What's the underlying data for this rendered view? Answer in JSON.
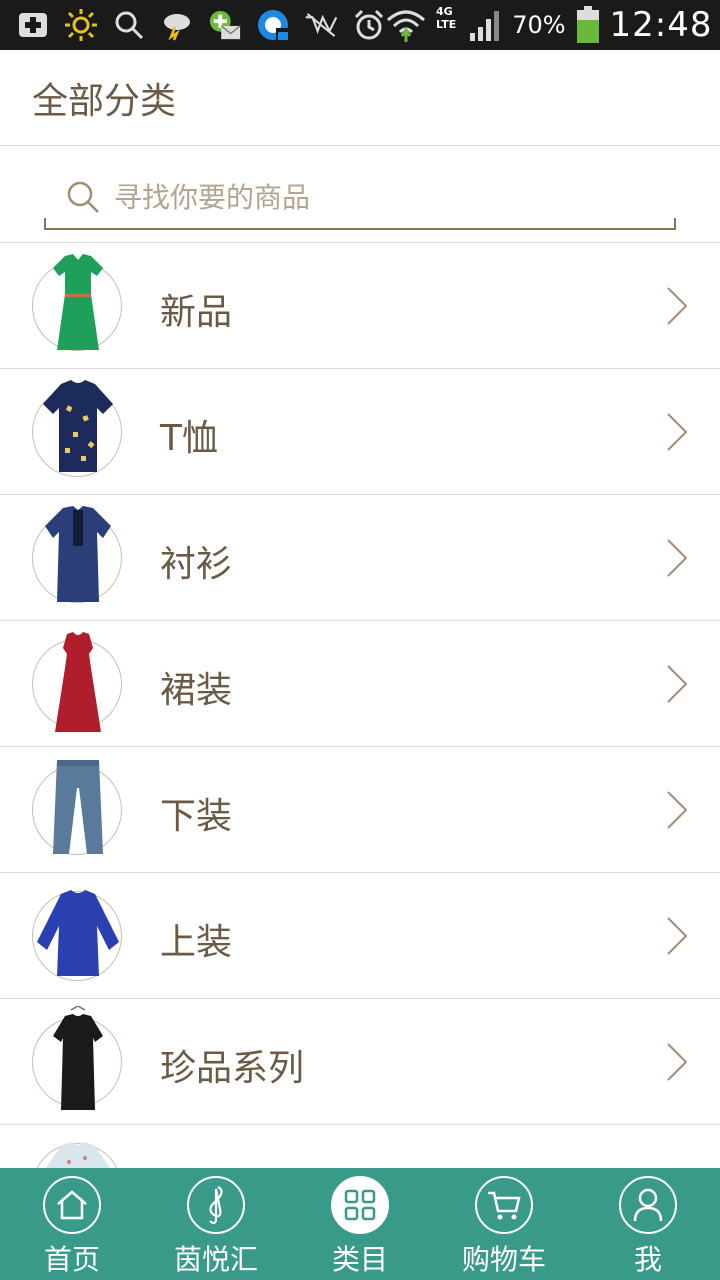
{
  "status_bar": {
    "icons": [
      "plus-box-icon",
      "sun-icon",
      "search-icon",
      "weather-icon",
      "mail-plus-icon",
      "browser-icon",
      "no-signal-icon",
      "alarm-icon",
      "wifi-icon",
      "network-4g-lte-icon",
      "signal-icon",
      "battery-icon"
    ],
    "network_label": "4G LTE",
    "battery_percent": "70%",
    "time": "12:48"
  },
  "header": {
    "title": "全部分类"
  },
  "search": {
    "placeholder": "寻找你要的商品",
    "value": ""
  },
  "categories": [
    {
      "label": "新品",
      "image": "green-dress",
      "color": "#1fa05a"
    },
    {
      "label": "T恤",
      "image": "navy-tshirt",
      "color": "#1d2b5c"
    },
    {
      "label": "衬衫",
      "image": "blue-shirt",
      "color": "#2a3f7a"
    },
    {
      "label": "裙装",
      "image": "red-dress",
      "color": "#b01e2e"
    },
    {
      "label": "下装",
      "image": "jeans",
      "color": "#5a7a9c"
    },
    {
      "label": "上装",
      "image": "blue-top",
      "color": "#2a3fb0"
    },
    {
      "label": "珍品系列",
      "image": "black-dress",
      "color": "#1a1a1a"
    },
    {
      "label": "",
      "image": "light-top",
      "color": "#d9e6ee"
    }
  ],
  "bottom_nav": [
    {
      "label": "首页",
      "icon": "home-icon",
      "active": false
    },
    {
      "label": "茵悦汇",
      "icon": "music-note-icon",
      "active": false
    },
    {
      "label": "类目",
      "icon": "grid-icon",
      "active": true
    },
    {
      "label": "购物车",
      "icon": "cart-icon",
      "active": false
    },
    {
      "label": "我",
      "icon": "user-icon",
      "active": false
    }
  ],
  "colors": {
    "accent": "#3a9a8a",
    "text": "#6b5a45",
    "divider": "#dcdcdc"
  }
}
